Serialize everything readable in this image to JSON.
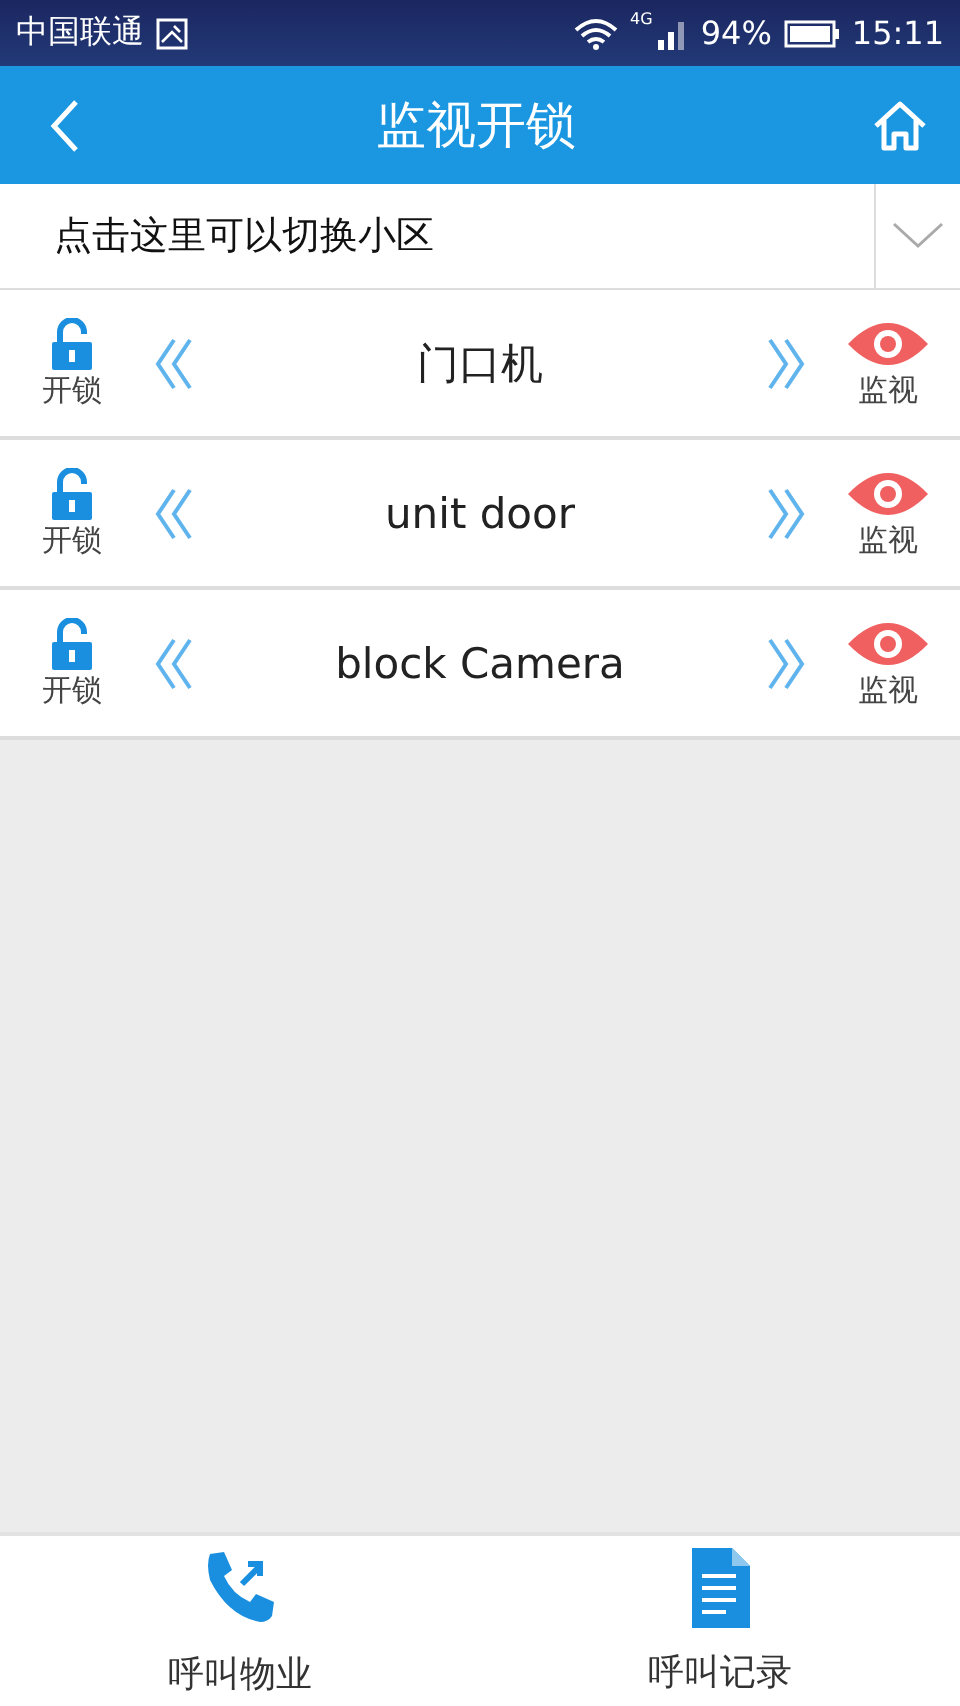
{
  "status_bar": {
    "carrier": "中国联通",
    "network": "4G",
    "battery": "94%",
    "time": "15:11"
  },
  "header": {
    "title": "监视开锁"
  },
  "community_selector": {
    "placeholder": "点击这里可以切换小区"
  },
  "devices": [
    {
      "unlock_label": "开锁",
      "name": "门口机",
      "monitor_label": "监视"
    },
    {
      "unlock_label": "开锁",
      "name": "unit door",
      "monitor_label": "监视"
    },
    {
      "unlock_label": "开锁",
      "name": "block Camera",
      "monitor_label": "监视"
    }
  ],
  "bottom_nav": [
    {
      "kind": "call",
      "label": "呼叫物业"
    },
    {
      "kind": "records",
      "label": "呼叫记录"
    }
  ]
}
